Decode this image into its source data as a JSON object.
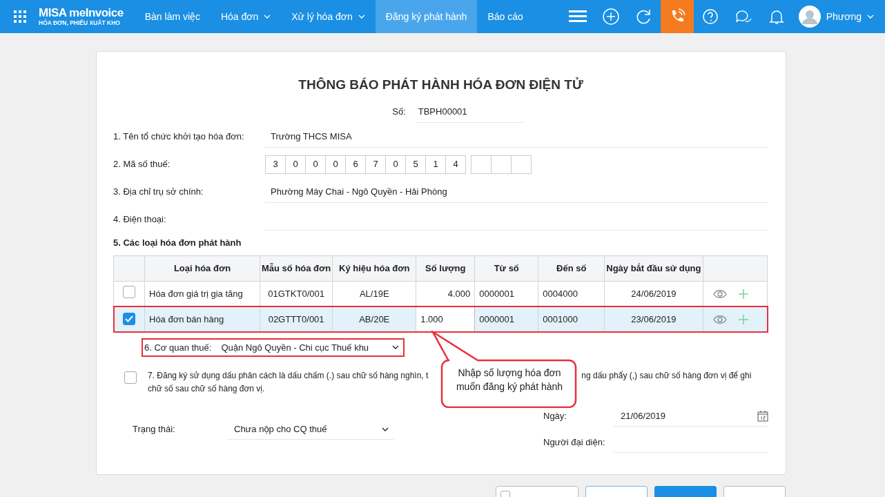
{
  "navbar": {
    "logo_title": "MISA meInvoice",
    "logo_subtitle": "HÓA ĐƠN, PHIẾU XUẤT KHO",
    "menu": [
      {
        "label": "Bàn làm việc",
        "dropdown": false,
        "selected": false
      },
      {
        "label": "Hóa đơn",
        "dropdown": true,
        "selected": false
      },
      {
        "label": "Xử lý hóa đơn",
        "dropdown": true,
        "selected": false
      },
      {
        "label": "Đăng ký phát hành",
        "dropdown": false,
        "selected": true
      },
      {
        "label": "Báo cáo",
        "dropdown": false,
        "selected": false
      }
    ],
    "user": "Phương"
  },
  "form": {
    "title": "THÔNG BÁO PHÁT HÀNH HÓA ĐƠN ĐIỆN TỬ",
    "number_label": "Số:",
    "number": "TBPH00001",
    "fields": [
      {
        "label": "1. Tên tổ chức khởi tạo hóa đơn:",
        "kind": "text",
        "value": "Trường THCS MISA"
      },
      {
        "label": "2. Mã số thuế:",
        "kind": "digits",
        "digits": [
          "3",
          "0",
          "0",
          "0",
          "6",
          "7",
          "0",
          "5",
          "1",
          "4"
        ],
        "extra_boxes": [
          {
            "filled": false
          },
          {
            "filled": false
          },
          {
            "filled": false
          }
        ]
      },
      {
        "label": "3. Địa chỉ trụ sở chính:",
        "kind": "text",
        "value": "Phường Máy Chai - Ngô Quyền - Hải Phòng"
      },
      {
        "label": "4. Điện thoại:",
        "kind": "text"
      }
    ],
    "section5": "5. Các loại hóa đơn phát hành",
    "table": {
      "columns": [
        "Loại hóa đơn",
        "Mẫu số hóa đơn",
        "Ký hiệu hóa đơn",
        "Số lượng",
        "Từ số",
        "Đến số",
        "Ngày bắt đầu sử dụng"
      ],
      "rows": [
        {
          "checked": false,
          "highlighted": false,
          "editing": false,
          "cells": [
            "Hóa đơn giá trị gia tăng",
            "01GTKT0/001",
            "AL/19E",
            "4.000",
            "0000001",
            "0004000",
            "24/06/2019"
          ]
        },
        {
          "checked": true,
          "highlighted": true,
          "editing": true,
          "cells": [
            "Hóa đơn bán hàng",
            "02GTTT0/001",
            "AB/20E",
            "1.000",
            "0000001",
            "0001000",
            "23/06/2019"
          ]
        }
      ]
    },
    "tax_office": {
      "label": "6. Cơ quan thuế:",
      "value": "Quận Ngô Quyền - Chi cục Thuế khu",
      "highlighted": true
    },
    "option7": {
      "checked": false,
      "line1_start": "7. Đăng ký sử dụng dấu phân cách là dấu chấm (.) sau chữ số hàng nghìn, t",
      "line1_end": "ng dấu phẩy (,) sau chữ số hàng đơn vị để ghi",
      "line2": "chữ số sau chữ số hàng đơn vị."
    },
    "status": {
      "label": "Trạng thái:",
      "value": "Chưa nộp cho CQ thuế"
    },
    "date": {
      "label": "Ngày:",
      "value": "21/06/2019"
    },
    "representative": {
      "label": "Người đại diện:"
    },
    "callout": "Nhập số lượng hóa đơn muốn đăng ký phát hành"
  },
  "footer_buttons": [
    {
      "kind": "checkbox-outline",
      "checked": false
    },
    {
      "kind": "outline"
    },
    {
      "kind": "primary"
    },
    {
      "kind": "plain"
    }
  ]
}
